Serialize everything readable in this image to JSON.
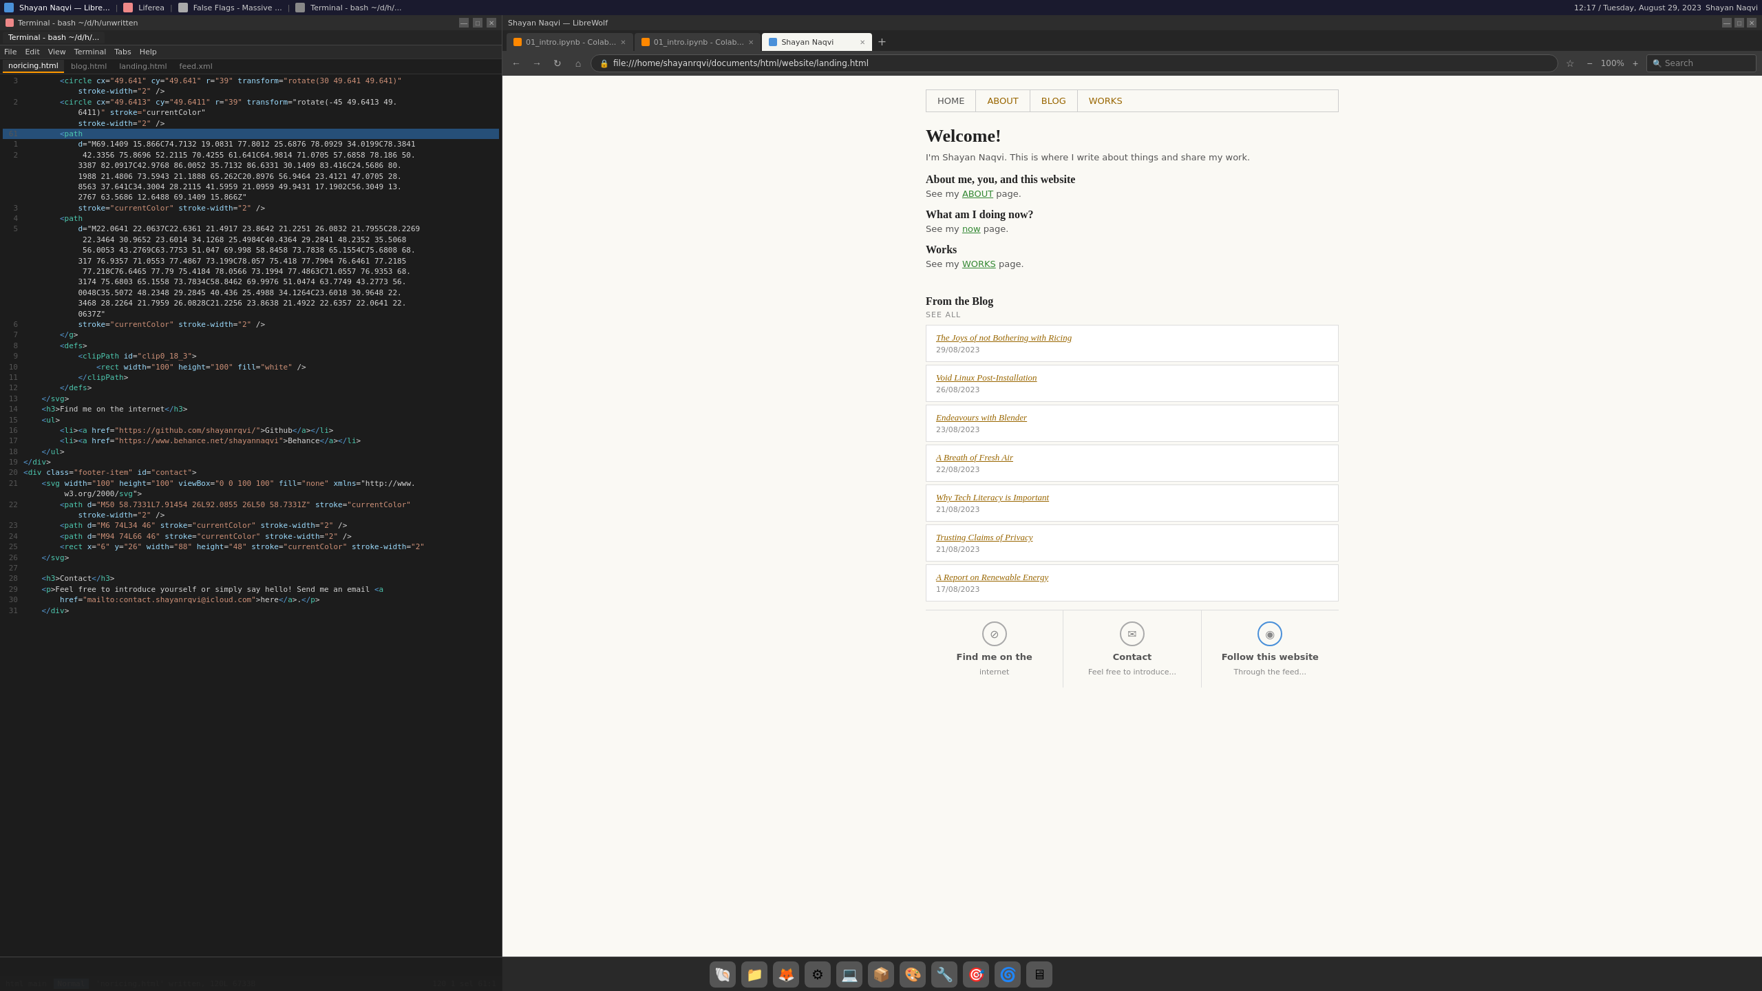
{
  "taskbar": {
    "left_items": [
      "Shayan Naqvi — Libre...",
      "Liferea",
      "False Flags - Massive ...",
      "Terminal - bash ~/d/h/..."
    ],
    "time": "12:17 / Tuesday, August 29, 2023",
    "user": "Shayan Naqvi"
  },
  "terminal": {
    "title": "Terminal - bash ~/d/h/unwritten",
    "tabs": [
      "Terminal - bash ~/d/h/..."
    ],
    "menu_items": [
      "File",
      "Edit",
      "View",
      "Terminal",
      "Tabs",
      "Help"
    ],
    "file_tabs": [
      "noricing.html",
      "blog.html",
      "landing.html",
      "feed.xml"
    ],
    "active_file": "noricing.html",
    "status_left": "html main",
    "status_mode": "Normal",
    "status_right": "120   1 sel  61:1",
    "status_bottom": "  'noricing.html' written, 120L 6733B"
  },
  "browser": {
    "title": "Shayan Naqvi — LibreWolf",
    "tabs": [
      {
        "label": "01_intro.ipynb - Colab...",
        "active": false
      },
      {
        "label": "01_intro.ipynb - Colab...",
        "active": false
      },
      {
        "label": "Shayan Naqvi",
        "active": true
      }
    ],
    "url": "file:///home/shayanrqvi/documents/html/website/landing.html",
    "zoom": "100%",
    "search_placeholder": "Search"
  },
  "website": {
    "nav": [
      {
        "label": "HOME",
        "active": true
      },
      {
        "label": "ABOUT"
      },
      {
        "label": "BLOG"
      },
      {
        "label": "WORKS"
      }
    ],
    "welcome": {
      "title": "Welcome!",
      "description": "I'm Shayan Naqvi. This is where I write about things and share my work.",
      "sections": [
        {
          "heading": "About me, you, and this website",
          "text_before": "See my ",
          "link": "ABOUT",
          "text_after": " page."
        },
        {
          "heading": "What am I doing now?",
          "text_before": "See my ",
          "link": "now",
          "text_after": " page."
        },
        {
          "heading": "Works",
          "text_before": "See my ",
          "link": "WORKS",
          "text_after": " page."
        }
      ]
    },
    "blog": {
      "heading": "From the Blog",
      "see_all": "SEE ALL",
      "posts": [
        {
          "title": "The Joys of not Bothering with Ricing",
          "date": "29/08/2023"
        },
        {
          "title": "Void Linux Post-Installation",
          "date": "26/08/2023"
        },
        {
          "title": "Endeavours with Blender",
          "date": "23/08/2023"
        },
        {
          "title": "A Breath of Fresh Air",
          "date": "22/08/2023"
        },
        {
          "title": "Why Tech Literacy is Important",
          "date": "21/08/2023"
        },
        {
          "title": "Trusting Claims of Privacy",
          "date": "21/08/2023"
        },
        {
          "title": "A Report on Renewable Energy",
          "date": "17/08/2023"
        }
      ]
    },
    "footer": [
      {
        "icon": "⊘",
        "label": "Find me on the",
        "sublabel": "internet"
      },
      {
        "icon": "✉",
        "label": "Contact",
        "sublabel": "Feel free to introduce..."
      },
      {
        "icon": "◉",
        "label": "Follow this website",
        "sublabel": "Through the feed..."
      }
    ]
  },
  "code_lines": [
    {
      "num": "3",
      "content": "        <circle cx=\"49.641\" cy=\"49.641\" r=\"39\" transform=\"rotate(30 49.641 49.641)\""
    },
    {
      "num": "",
      "content": "            stroke-width=\"2\" />"
    },
    {
      "num": "2",
      "content": "        <circle cx=\"49.6413\" cy=\"49.6411\" r=\"39\" transform=\"rotate(-45 49.6413 49."
    },
    {
      "num": "",
      "content": "            6411)\" stroke=\"currentColor\""
    },
    {
      "num": "",
      "content": "            stroke-width=\"2\" />"
    },
    {
      "num": "61",
      "content": "        <path"
    },
    {
      "num": "1",
      "content": "            d=\"M69.1409 15.866C74.7132 19.0831 77.8012 25.6876 78.0929 34.0199C78.3841"
    },
    {
      "num": "2",
      "content": "             42.3356 75.8696 52.2115 70.4255 61.641C64.9814 71.0705 57.6858 78.186 50."
    },
    {
      "num": "",
      "content": "            3387 82.0917C42.9768 86.0052 35.7132 86.6331 30.1409 83.416C24.5686 80."
    },
    {
      "num": "",
      "content": "            1988 21.4806 73.5943 21.1888 65.262C20.8976 56.9464 23.4121 47.0705 28."
    },
    {
      "num": "",
      "content": "            8563 37.641C34.3004 28.2115 41.5959 21.0959 49.9431 17.1902C56.3049 13."
    },
    {
      "num": "",
      "content": "            2767 63.5686 12.6488 69.1409 15.866Z\""
    },
    {
      "num": "3",
      "content": "            stroke=\"currentColor\" stroke-width=\"2\" />"
    },
    {
      "num": "4",
      "content": "        <path"
    },
    {
      "num": "5",
      "content": "            d=\"M22.0641 22.0637C22.6361 21.4917 23.8642 21.2251 26.0832 21.7955C28.2269"
    },
    {
      "num": "",
      "content": "             22.3464 30.9652 23.6014 34.1268 25.4984C40.4364 29.2841 48.2352 35.5068"
    },
    {
      "num": "",
      "content": "             56.0053 43.2769C63.7753 51.047 69.998 58.8458 73.7838 65.1554C75.6808 68."
    },
    {
      "num": "",
      "content": "            317 76.9357 71.0553 77.4867 73.199C78.057 75.418 77.7904 76.6461 77.2185"
    },
    {
      "num": "",
      "content": "             77.218C76.6465 77.79 75.4184 78.0566 73.1994 77.4863C71.0557 76.9353 68."
    },
    {
      "num": "",
      "content": "            3174 75.6803 65.1558 73.7834C58.8462 69.9976 51.0474 63.7749 43.2773 56."
    },
    {
      "num": "",
      "content": "            0048C35.5072 48.2348 29.2845 40.436 25.4988 34.1264C23.6018 30.9648 22."
    },
    {
      "num": "",
      "content": "            3468 28.2264 21.7959 26.0828C21.2256 23.8638 21.4922 22.6357 22.0641 22."
    },
    {
      "num": "",
      "content": "            0637Z\""
    },
    {
      "num": "6",
      "content": "            stroke=\"currentColor\" stroke-width=\"2\" />"
    },
    {
      "num": "7",
      "content": "        </g>"
    },
    {
      "num": "8",
      "content": "        <defs>"
    },
    {
      "num": "9",
      "content": "            <clipPath id=\"clip0_18_3\">"
    },
    {
      "num": "10",
      "content": "                <rect width=\"100\" height=\"100\" fill=\"white\" />"
    },
    {
      "num": "11",
      "content": "            </clipPath>"
    },
    {
      "num": "12",
      "content": "        </defs>"
    },
    {
      "num": "13",
      "content": "    </svg>"
    },
    {
      "num": "14",
      "content": "    <h3>Find me on the internet</h3>"
    },
    {
      "num": "15",
      "content": "    <ul>"
    },
    {
      "num": "16",
      "content": "        <li><a href=\"https://github.com/shayanrqvi/\">Github</a></li>"
    },
    {
      "num": "17",
      "content": "        <li><a href=\"https://www.behance.net/shayannaqvi\">Behance</a></li>"
    },
    {
      "num": "18",
      "content": "    </ul>"
    },
    {
      "num": "19",
      "content": "</div>"
    },
    {
      "num": "20",
      "content": "<div class=\"footer-item\" id=\"contact\">"
    },
    {
      "num": "21",
      "content": "    <svg width=\"100\" height=\"100\" viewBox=\"0 0 100 100\" fill=\"none\" xmlns=\"http://www."
    },
    {
      "num": "",
      "content": "         w3.org/2000/svg\">"
    },
    {
      "num": "22",
      "content": "        <path d=\"M50 58.7331L7.91454 26L92.0855 26L50 58.7331Z\" stroke=\"currentColor\""
    },
    {
      "num": "",
      "content": "            stroke-width=\"2\" />"
    },
    {
      "num": "23",
      "content": "        <path d=\"M6 74L34 46\" stroke=\"currentColor\" stroke-width=\"2\" />"
    },
    {
      "num": "24",
      "content": "        <path d=\"M94 74L66 46\" stroke=\"currentColor\" stroke-width=\"2\" />"
    },
    {
      "num": "25",
      "content": "        <rect x=\"6\" y=\"26\" width=\"88\" height=\"48\" stroke=\"currentColor\" stroke-width=\"2\""
    },
    {
      "num": "26",
      "content": "    </svg>"
    },
    {
      "num": "27",
      "content": ""
    },
    {
      "num": "28",
      "content": "    <h3>Contact</h3>"
    },
    {
      "num": "29",
      "content": "    <p>Feel free to introduce yourself or simply say hello! Send me an email <a"
    },
    {
      "num": "30",
      "content": "        href=\"mailto:contact.shayanrqvi@icloud.com\">here</a>.</p>"
    },
    {
      "num": "31",
      "content": "    </div>"
    }
  ],
  "dock": {
    "icons": [
      "🐚",
      "📁",
      "🌐",
      "⚙️",
      "💻",
      "📦",
      "🎨",
      "🔧",
      "🎯",
      "🌀",
      "🖥️"
    ]
  }
}
